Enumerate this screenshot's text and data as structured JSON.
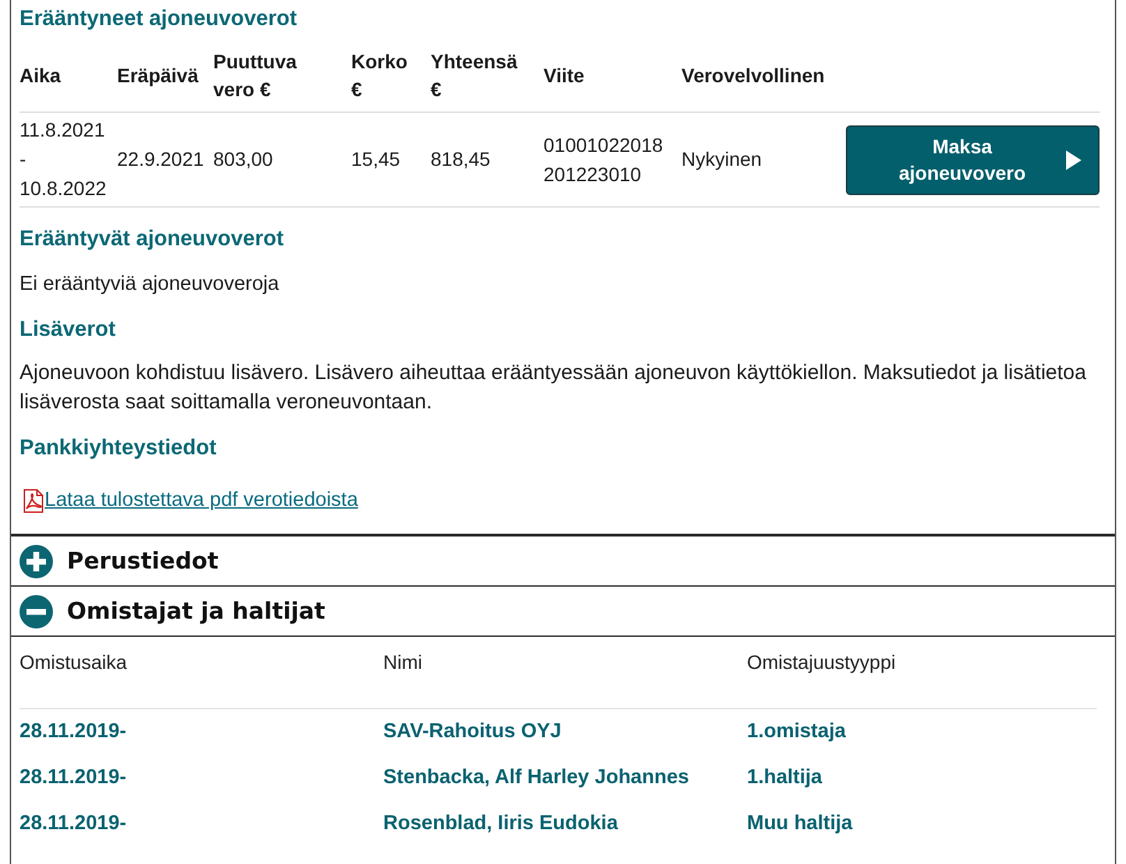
{
  "overdue": {
    "title": "Erääntyneet ajoneuvoverot",
    "columns": [
      "Aika",
      "Eräpäivä",
      "Puuttuva vero €",
      "Korko €",
      "Yhteensä €",
      "Viite",
      "Verovelvollinen"
    ],
    "rows": [
      {
        "cells": [
          "11.8.2021 - 10.8.2022",
          "22.9.2021",
          "803,00",
          "15,45",
          "818,45",
          "01001022018 201223010",
          "Nykyinen"
        ],
        "action": "Maksa ajoneuvovero"
      }
    ]
  },
  "upcoming": {
    "title": "Erääntyvät ajoneuvoverot",
    "text": "Ei erääntyviä ajoneuvoveroja"
  },
  "extra_tax": {
    "title": "Lisäverot",
    "text": "Ajoneuvoon kohdistuu lisävero. Lisävero aiheuttaa erääntyessään ajoneuvon käyttökiellon. Maksutiedot ja lisätietoa lisäverosta saat soittamalla veroneuvontaan."
  },
  "bank": {
    "title": "Pankkiyhteystiedot"
  },
  "pdf_link": "Lataa tulostettava pdf verotiedoista",
  "accordions": [
    {
      "title": "Perustiedot",
      "expanded": false
    },
    {
      "title": "Omistajat ja haltijat",
      "expanded": true,
      "table": {
        "columns": [
          "Omistusaika",
          "Nimi",
          "Omistajuustyyppi"
        ],
        "rows": [
          [
            "28.11.2019-",
            "SAV-Rahoitus OYJ",
            "1.omistaja"
          ],
          [
            "28.11.2019-",
            "Stenbacka, Alf Harley Johannes",
            "1.haltija"
          ],
          [
            "28.11.2019-",
            "Rosenblad, Iiris Eudokia",
            "Muu haltija"
          ]
        ]
      }
    }
  ]
}
